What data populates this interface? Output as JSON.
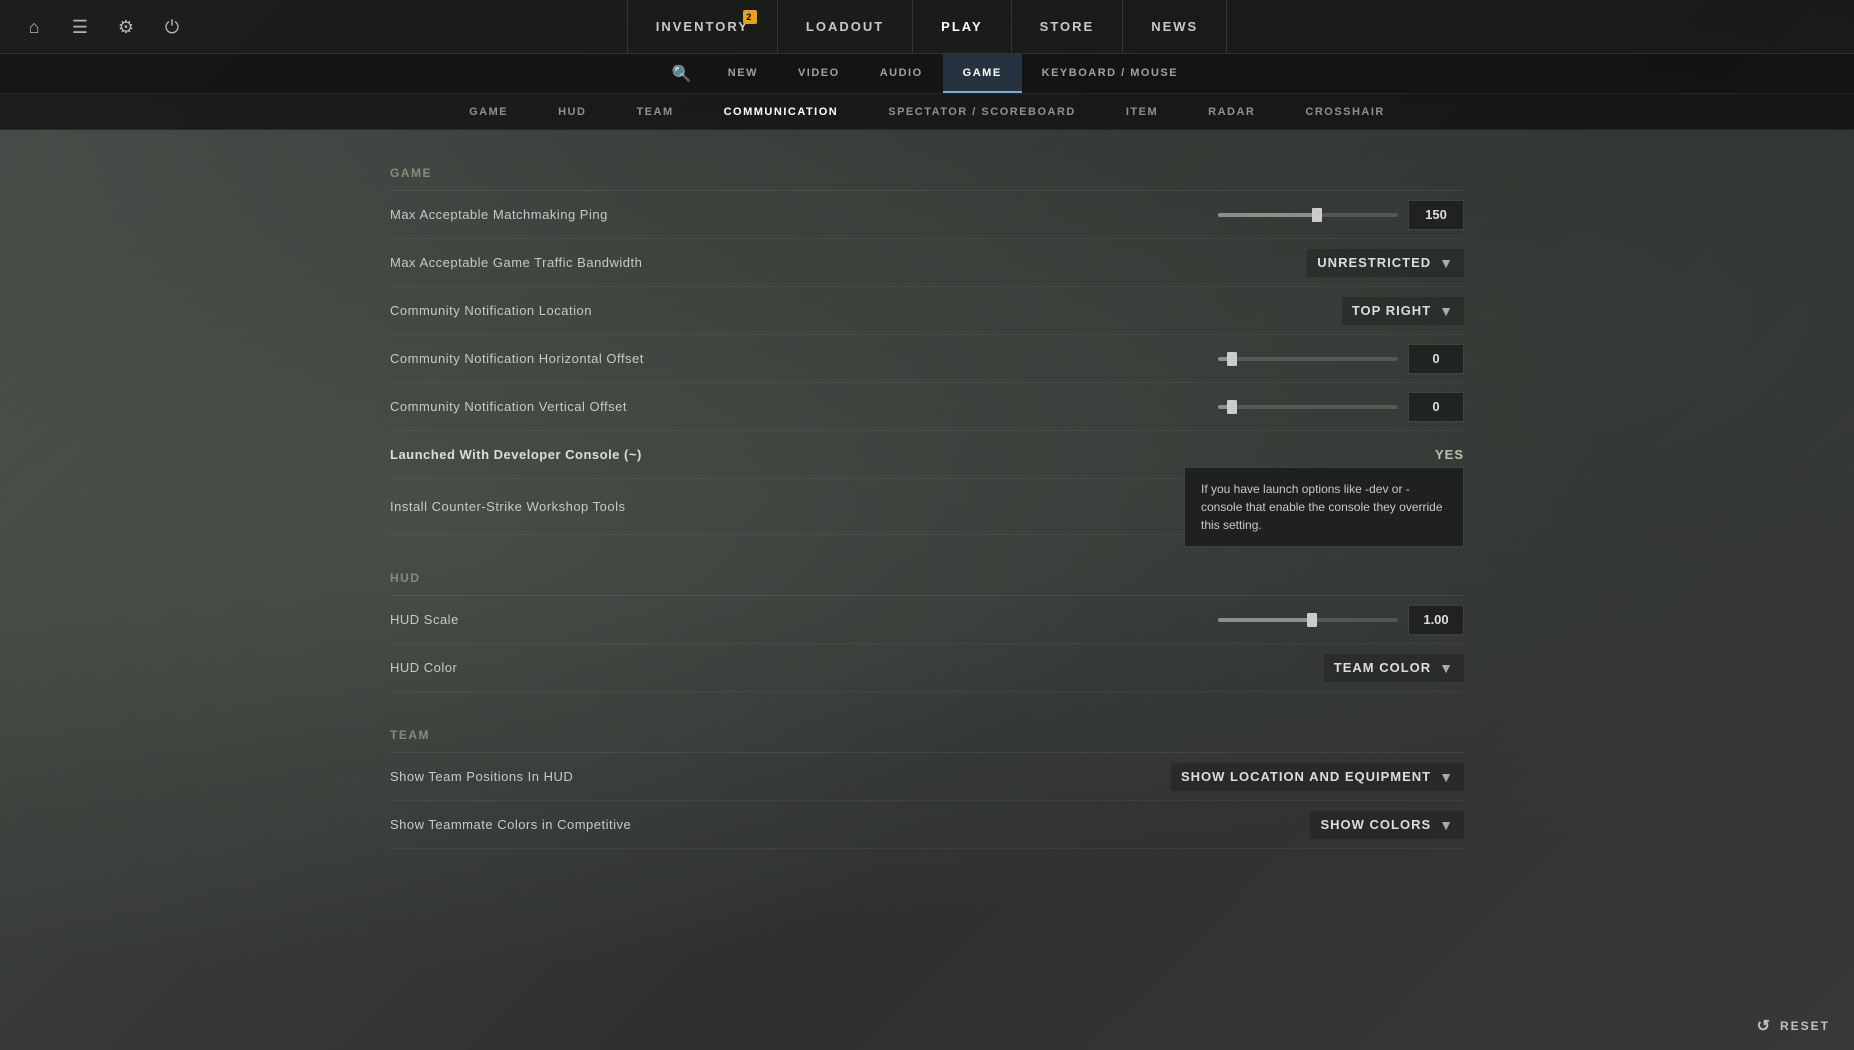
{
  "nav": {
    "top_links": [
      {
        "id": "inventory",
        "label": "INVENTORY",
        "badge": "2",
        "active": false
      },
      {
        "id": "loadout",
        "label": "LOADOUT",
        "badge": null,
        "active": false
      },
      {
        "id": "play",
        "label": "PLAY",
        "badge": null,
        "active": true
      },
      {
        "id": "store",
        "label": "STORE",
        "badge": null,
        "active": false
      },
      {
        "id": "news",
        "label": "NEWS",
        "badge": null,
        "active": false
      }
    ],
    "secondary_links": [
      {
        "id": "new",
        "label": "NEW",
        "active": false
      },
      {
        "id": "video",
        "label": "VIDEO",
        "active": false
      },
      {
        "id": "audio",
        "label": "AUDIO",
        "active": false
      },
      {
        "id": "game",
        "label": "GAME",
        "active": true
      },
      {
        "id": "keyboard-mouse",
        "label": "KEYBOARD / MOUSE",
        "active": false
      }
    ],
    "tertiary_links": [
      {
        "id": "game",
        "label": "GAME",
        "active": false
      },
      {
        "id": "hud",
        "label": "HUD",
        "active": false
      },
      {
        "id": "team",
        "label": "TEAM",
        "active": false
      },
      {
        "id": "communication",
        "label": "COMMUNICATION",
        "active": true
      },
      {
        "id": "spectator-scoreboard",
        "label": "SPECTATOR / SCOREBOARD",
        "active": false
      },
      {
        "id": "item",
        "label": "ITEM",
        "active": false
      },
      {
        "id": "radar",
        "label": "RADAR",
        "active": false
      },
      {
        "id": "crosshair",
        "label": "CROSSHAIR",
        "active": false
      }
    ]
  },
  "sections": {
    "game": {
      "label": "Game",
      "settings": [
        {
          "id": "max-ping",
          "label": "Max Acceptable Matchmaking Ping",
          "type": "slider",
          "value": "150",
          "slider_percent": 55
        },
        {
          "id": "bandwidth",
          "label": "Max Acceptable Game Traffic Bandwidth",
          "type": "dropdown",
          "value": "UNRESTRICTED"
        },
        {
          "id": "notif-location",
          "label": "Community Notification Location",
          "type": "dropdown",
          "value": "TOP RIGHT"
        },
        {
          "id": "notif-horiz",
          "label": "Community Notification Horizontal Offset",
          "type": "slider",
          "value": "0",
          "slider_percent": 8
        },
        {
          "id": "notif-vert",
          "label": "Community Notification Vertical Offset",
          "type": "slider",
          "value": "0",
          "slider_percent": 8
        },
        {
          "id": "dev-console",
          "label": "Launched With Developer Console (~)",
          "type": "yes-no",
          "value": "YES",
          "bold": true,
          "has_tooltip": false
        },
        {
          "id": "workshop-tools",
          "label": "Install Counter-Strike Workshop Tools",
          "type": "install",
          "has_tooltip": true,
          "tooltip": "If you have launch options like -dev or -console that enable the console they override this setting."
        }
      ]
    },
    "hud": {
      "label": "Hud",
      "settings": [
        {
          "id": "hud-scale",
          "label": "HUD Scale",
          "type": "slider",
          "value": "1.00",
          "slider_percent": 52
        },
        {
          "id": "hud-color",
          "label": "HUD Color",
          "type": "dropdown",
          "value": "TEAM COLOR"
        }
      ]
    },
    "team": {
      "label": "Team",
      "settings": [
        {
          "id": "team-positions",
          "label": "Show Team Positions In HUD",
          "type": "dropdown",
          "value": "SHOW LOCATION AND EQUIPMENT"
        },
        {
          "id": "teammate-colors",
          "label": "Show Teammate Colors in Competitive",
          "type": "dropdown",
          "value": "SHOW COLORS"
        }
      ]
    }
  },
  "bottom": {
    "reset_label": "RESET",
    "reset_icon": "↺"
  }
}
